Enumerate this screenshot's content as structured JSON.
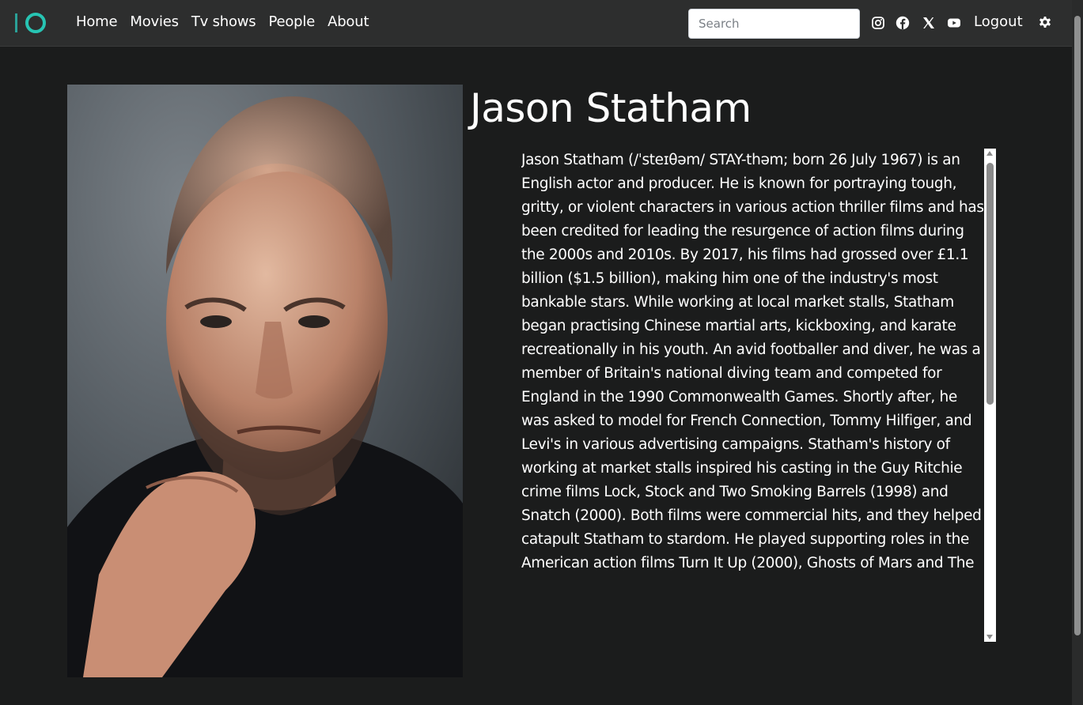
{
  "nav": {
    "links": [
      "Home",
      "Movies",
      "Tv shows",
      "People",
      "About"
    ],
    "search_placeholder": "Search",
    "logout_label": "Logout",
    "social_icons": [
      "instagram-icon",
      "facebook-icon",
      "x-icon",
      "youtube-icon"
    ],
    "accent_color": "#27c4b3"
  },
  "person": {
    "name": "Jason Statham",
    "photo_alt": "Jason Statham portrait",
    "bio": "Jason Statham (/ˈsteɪθəm/ STAY-thəm; born 26 July 1967) is an English actor and producer. He is known for portraying tough, gritty, or violent characters in various action thriller films and has been credited for leading the resurgence of action films during the 2000s and 2010s. By 2017, his films had grossed over £1.1 billion ($1.5 billion), making him one of the industry's most bankable stars. While working at local market stalls, Statham began practising Chinese martial arts, kickboxing, and karate recreationally in his youth. An avid footballer and diver, he was a member of Britain's national diving team and competed for England in the 1990 Commonwealth Games. Shortly after, he was asked to model for French Connection, Tommy Hilfiger, and Levi's in various advertising campaigns. Statham's history of working at market stalls inspired his casting in the Guy Ritchie crime films Lock, Stock and Two Smoking Barrels (1998) and Snatch (2000). Both films were commercial hits, and they helped catapult Statham to stardom. He played supporting roles in the American action films Turn It Up (2000), Ghosts of Mars and The"
  }
}
